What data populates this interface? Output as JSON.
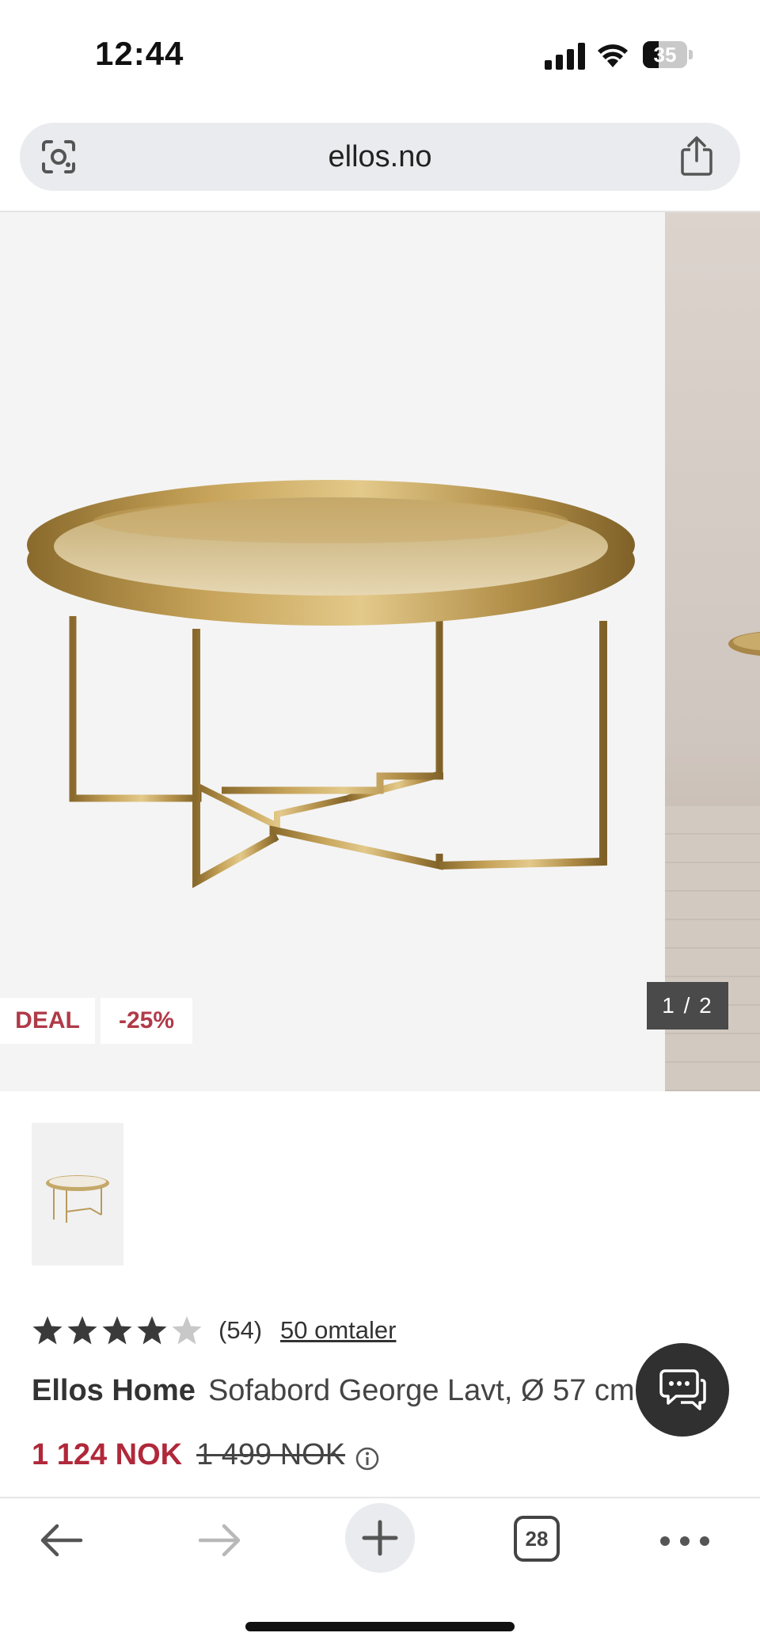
{
  "status_bar": {
    "time": "12:44",
    "battery": "35",
    "battery_level": 0.35
  },
  "browser": {
    "url": "ellos.no",
    "tab_count": "28"
  },
  "gallery": {
    "badges": {
      "deal": "DEAL",
      "discount": "-25%"
    },
    "counter": "1 / 2"
  },
  "product": {
    "rating": 4,
    "rating_max": 5,
    "rating_count": "(54)",
    "reviews_link": "50 omtaler",
    "brand": "Ellos Home",
    "name": "Sofabord George Lavt, Ø 57 cm",
    "price_now": "1 124 NOK",
    "price_old": "1 499 NOK"
  },
  "colors": {
    "accent_red": "#b0283a",
    "deal_red": "#b03a48",
    "dark": "#303030"
  },
  "icons": {
    "url_left": "lens-icon",
    "url_right": "share-icon",
    "chat": "chat-icon",
    "info": "info-icon"
  }
}
